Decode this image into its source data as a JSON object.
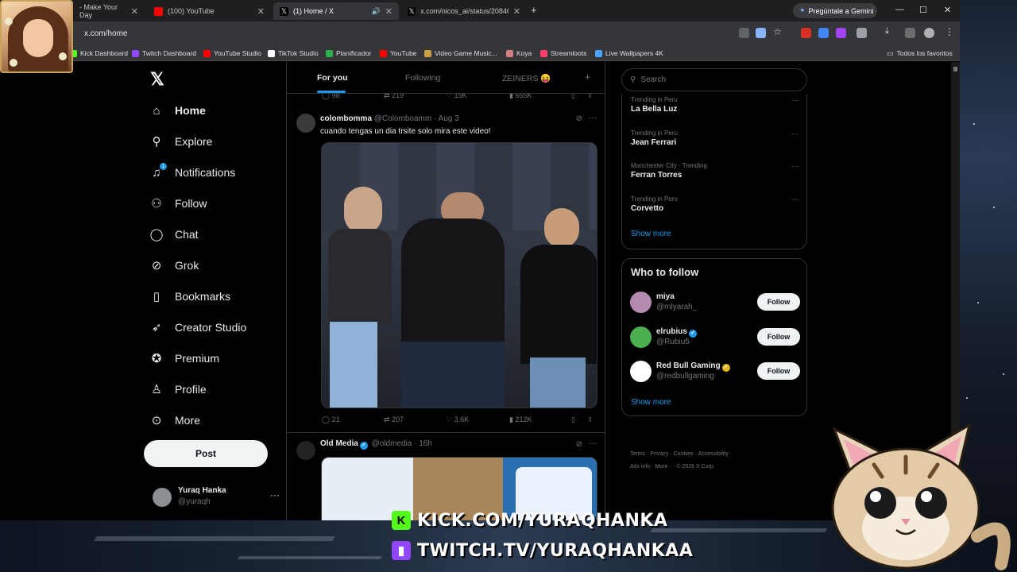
{
  "browser": {
    "tabs": [
      {
        "title": "- Make Your Day",
        "active": false
      },
      {
        "title": "(100) YouTube",
        "active": false
      },
      {
        "title": "(1) Home / X",
        "active": true
      },
      {
        "title": "x.com/nicos_ai/status/20846406",
        "active": false
      }
    ],
    "new_tab": "+",
    "gemini_label": "Pregúntale a Gemini",
    "url": "x.com/home",
    "bookmarks": [
      {
        "label": "Kick Dashboard",
        "color": "#53fc18"
      },
      {
        "label": "Twitch Dashboard",
        "color": "#9146ff"
      },
      {
        "label": "YouTube Studio",
        "color": "#ff0000"
      },
      {
        "label": "TikTok Studio",
        "color": "#ffffff"
      },
      {
        "label": "Planificador",
        "color": "#2bb24c"
      },
      {
        "label": "YouTube",
        "color": "#ff0000"
      },
      {
        "label": "Video Game Music...",
        "color": "#c8a040"
      },
      {
        "label": "Koya",
        "color": "#d08080"
      },
      {
        "label": "Streamloots",
        "color": "#ff3d6e"
      },
      {
        "label": "Live Wallpapers 4K",
        "color": "#4aa3ff"
      }
    ],
    "all_bookmarks": "Todos los favoritos"
  },
  "nav": {
    "items": [
      {
        "label": "Home",
        "icon": "home-icon",
        "glyph": "⌂"
      },
      {
        "label": "Explore",
        "icon": "search-icon",
        "glyph": "⚲"
      },
      {
        "label": "Notifications",
        "icon": "bell-icon",
        "glyph": "♫"
      },
      {
        "label": "Follow",
        "icon": "person-add-icon",
        "glyph": "⚇"
      },
      {
        "label": "Chat",
        "icon": "chat-icon",
        "glyph": "◯"
      },
      {
        "label": "Grok",
        "icon": "grok-icon",
        "glyph": "⊘"
      },
      {
        "label": "Bookmarks",
        "icon": "bookmark-icon",
        "glyph": "▯"
      },
      {
        "label": "Creator Studio",
        "icon": "rocket-icon",
        "glyph": "➶"
      },
      {
        "label": "Premium",
        "icon": "premium-icon",
        "glyph": "✪"
      },
      {
        "label": "Profile",
        "icon": "profile-icon",
        "glyph": "♙"
      },
      {
        "label": "More",
        "icon": "more-icon",
        "glyph": "⊙"
      }
    ],
    "notifications_badge": "1",
    "post_label": "Post",
    "account": {
      "name": "Yuraq Hanka",
      "handle": "@yuraqh"
    }
  },
  "feed": {
    "tabs": [
      "For you",
      "Following",
      "ZEINERS 😝"
    ],
    "prev_metrics": {
      "replies": "98",
      "reposts": "219",
      "likes": "15K",
      "views": "655K"
    },
    "tweets": [
      {
        "name": "colombomma",
        "handle": "@Colomboamm · Aug 3",
        "text": "cuando tengas un dia trsite solo mira este video!",
        "metrics": {
          "replies": "21",
          "reposts": "207",
          "likes": "3.6K",
          "views": "212K"
        }
      },
      {
        "name": "Old Media",
        "handle": "@oldmedia · 16h",
        "text": ""
      }
    ]
  },
  "right": {
    "search_placeholder": "Search",
    "trends": [
      {
        "context": "Trending in Peru",
        "title": "La Bella Luz"
      },
      {
        "context": "Trending in Peru",
        "title": "Jean Ferrari"
      },
      {
        "context": "Manchester City · Trending",
        "title": "Ferran Torres"
      },
      {
        "context": "Trending in Peru",
        "title": "Corvetto"
      }
    ],
    "show_more": "Show more",
    "who_to_follow_title": "Who to follow",
    "who_to_follow": [
      {
        "name": "miya",
        "handle": "@mlyarah_",
        "verified": "",
        "color": "#b48ab0"
      },
      {
        "name": "elrubius",
        "handle": "@Rubiu5",
        "verified": "blue",
        "color": "#4caf50"
      },
      {
        "name": "Red Bull Gaming",
        "handle": "@redbullgaming",
        "verified": "gold",
        "color": "#ffffff"
      }
    ],
    "follow_label": "Follow",
    "footer": [
      "Terms",
      "Privacy",
      "Cookies",
      "Accessibility",
      "Ads info",
      "More ···",
      "© 2026 X Corp."
    ]
  },
  "overlay": {
    "kick": "KICK.COM/YURAQHANKA",
    "twitch": "TWITCH.TV/YURAQHANKAA",
    "kick_color": "#53fc18",
    "twitch_color": "#9146ff"
  }
}
